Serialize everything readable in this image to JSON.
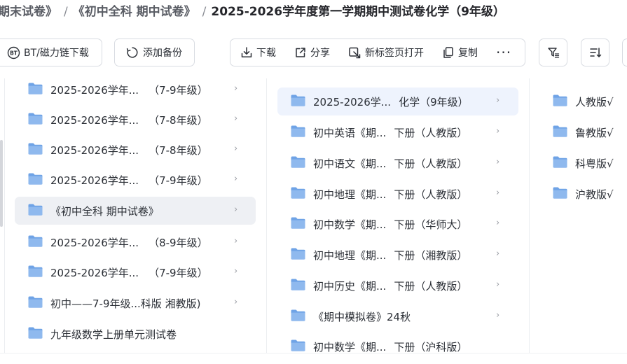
{
  "breadcrumb": {
    "items": [
      "期末试卷》",
      "《初中全科 期中试卷》",
      "2025-2026学年度第一学期期中测试卷化学（9年级）"
    ],
    "separator": "/"
  },
  "toolbar": {
    "bt_download": "BT/磁力链下载",
    "add_backup": "添加备份",
    "download": "下载",
    "share": "分享",
    "open_new_tab": "新标签页打开",
    "copy": "复制",
    "more": "···"
  },
  "columns": {
    "col1": [
      {
        "name": "2025-2026学年...",
        "suffix": "（7-9年级）"
      },
      {
        "name": "2025-2026学年...",
        "suffix": "（7-8年级）"
      },
      {
        "name": "2025-2026学年...",
        "suffix": "（7-8年级）"
      },
      {
        "name": "2025-2026学年...",
        "suffix": "（7-9年级）"
      },
      {
        "name": "《初中全科 期中试卷》",
        "suffix": ""
      },
      {
        "name": "2025-2026学年...",
        "suffix": "（8-9年级）"
      },
      {
        "name": "2025-2026学年...",
        "suffix": "（7-9年级）"
      },
      {
        "name": "初中——7-9年级...科版 湘教版)",
        "suffix": ""
      },
      {
        "name": "九年级数学上册单元测试卷",
        "suffix": ""
      }
    ],
    "col2": [
      {
        "name": "2025-2026学...",
        "suffix": "化学（9年级）"
      },
      {
        "name": "初中英语《期...",
        "suffix": "下册（人教版）"
      },
      {
        "name": "初中语文《期...",
        "suffix": "下册（人教版）"
      },
      {
        "name": "初中地理《期...",
        "suffix": "下册（人教版）"
      },
      {
        "name": "初中数学《期...",
        "suffix": "下册（华师大）"
      },
      {
        "name": "初中地理《期...",
        "suffix": "下册（湘教版）"
      },
      {
        "name": "初中历史《期...",
        "suffix": "下册（人教版）"
      },
      {
        "name": "《期中模拟卷》24秋",
        "suffix": ""
      },
      {
        "name": "初中数学《期...",
        "suffix": "下册（沪科版）"
      }
    ],
    "col3": [
      {
        "name": "人教版√"
      },
      {
        "name": "鲁教版√"
      },
      {
        "name": "科粤版√"
      },
      {
        "name": "沪教版√"
      }
    ]
  },
  "colors": {
    "folder": "#8fb9ee",
    "folder_tab": "#6fa3e6",
    "active_row": "#eef3fd",
    "selected_row": "#eef0f4"
  },
  "icons": {
    "folder": "folder-icon",
    "chevron": "chevron-right-icon"
  }
}
